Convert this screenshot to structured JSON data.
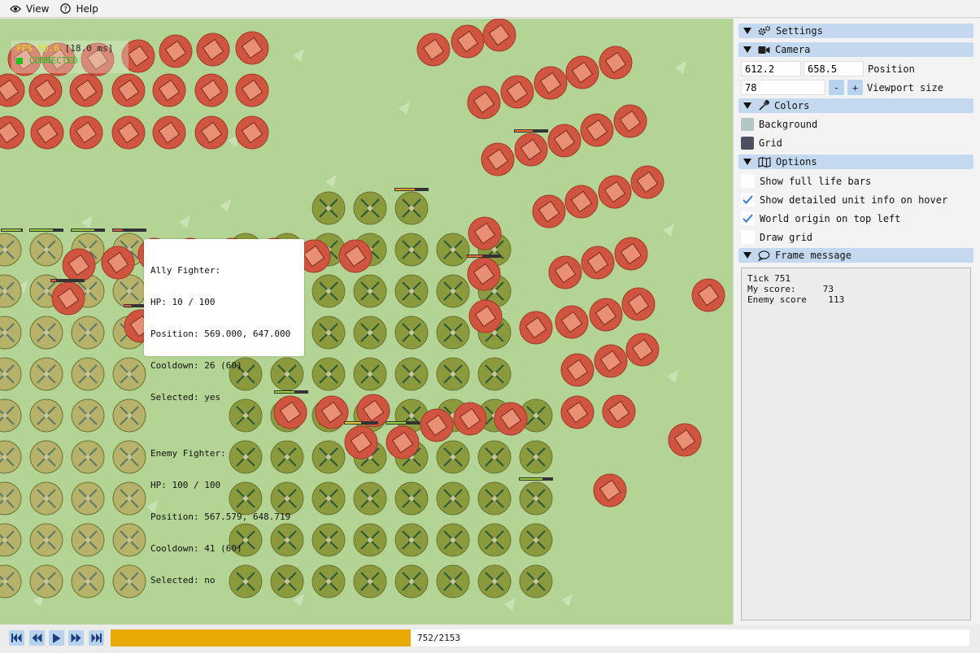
{
  "menu": {
    "view_label": "View",
    "help_label": "Help"
  },
  "overlay": {
    "fps_text": "FPS 55.6",
    "frame_ms": "[18.0 ms]",
    "connection_status": "CONNECTED"
  },
  "tooltip": {
    "ally": {
      "title": "Ally Fighter:",
      "hp": "HP: 10 / 100",
      "position": "Position: 569.000, 647.000",
      "cooldown": "Cooldown: 26 (60)",
      "selected": "Selected: yes"
    },
    "enemy": {
      "title": "Enemy Fighter:",
      "hp": "HP: 100 / 100",
      "position": "Position: 567.579, 648.719",
      "cooldown": "Cooldown: 41 (60)",
      "selected": "Selected: no"
    }
  },
  "settings": {
    "title": "Settings",
    "camera": {
      "title": "Camera",
      "pos_x": "612.2",
      "pos_y": "658.5",
      "position_label": "Position",
      "viewport_value": "78",
      "minus": "-",
      "plus": "+",
      "viewport_label": "Viewport size"
    },
    "colors": {
      "title": "Colors",
      "background_label": "Background",
      "grid_label": "Grid",
      "background_color": "#b4c6c8",
      "grid_color": "#4c5060"
    },
    "options": {
      "title": "Options",
      "items": [
        {
          "label": "Show full life bars",
          "checked": false
        },
        {
          "label": "Show detailed unit info on hover",
          "checked": true
        },
        {
          "label": "World origin on top left",
          "checked": true
        },
        {
          "label": "Draw grid",
          "checked": false
        }
      ]
    },
    "frame_message": {
      "title": "Frame message",
      "lines": [
        "Tick 751",
        "My score:     73",
        "Enemy score    113"
      ]
    }
  },
  "timeline": {
    "progress_label": "752/2153",
    "current_tick": 752,
    "total_ticks": 2153
  },
  "colors": {
    "world_background": "#b3d495",
    "ally_unit": "#8a9a3c",
    "ally_unit_light": "#b7b26a",
    "enemy_unit": "#cf5540",
    "accent": "#c4d9ef",
    "progress_fill": "#e8ab06"
  }
}
